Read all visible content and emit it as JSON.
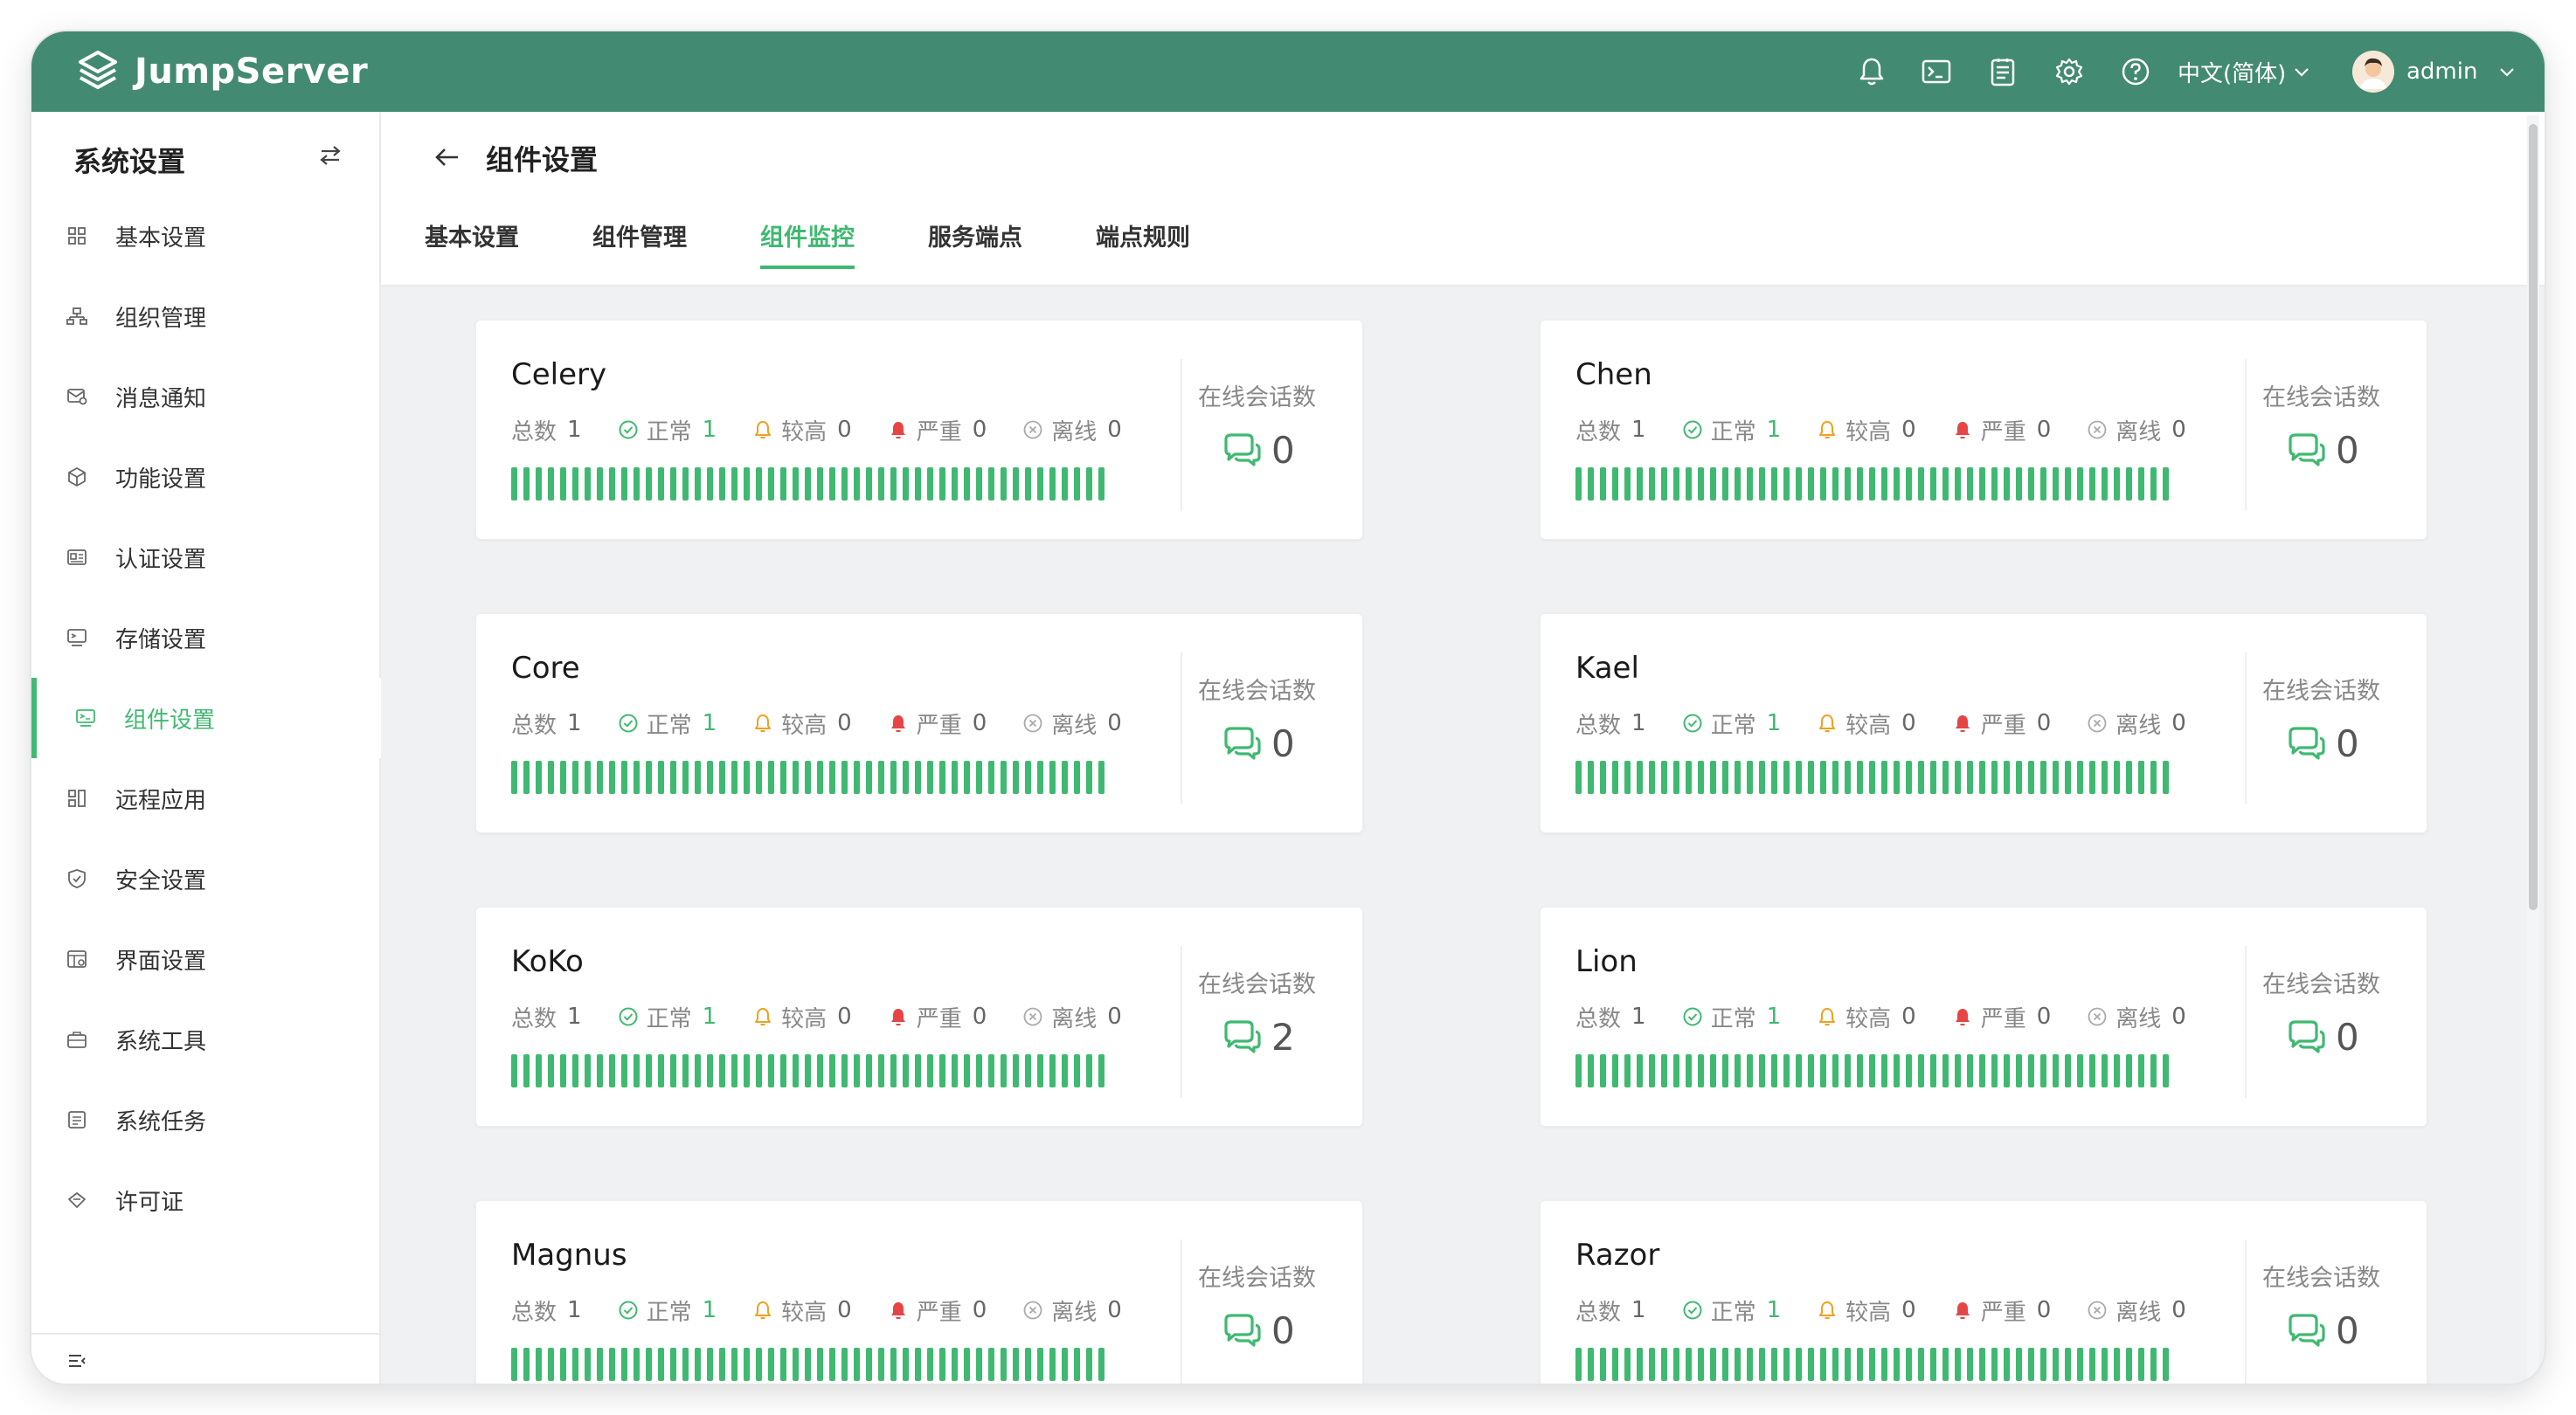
{
  "app": {
    "logo_text": "JumpServer"
  },
  "topbar": {
    "icons": [
      "bell-icon",
      "terminal-icon",
      "notes-icon",
      "settings-icon",
      "help-icon"
    ],
    "language": "中文(简体)",
    "user": "admin"
  },
  "sidebar": {
    "title": "系统设置",
    "items": [
      {
        "label": "基本设置",
        "icon": "grid-icon"
      },
      {
        "label": "组织管理",
        "icon": "org-tree-icon"
      },
      {
        "label": "消息通知",
        "icon": "message-icon"
      },
      {
        "label": "功能设置",
        "icon": "cube-icon"
      },
      {
        "label": "认证设置",
        "icon": "id-card-icon"
      },
      {
        "label": "存储设置",
        "icon": "storage-icon"
      },
      {
        "label": "组件设置",
        "icon": "component-icon",
        "active": true
      },
      {
        "label": "远程应用",
        "icon": "apps-icon"
      },
      {
        "label": "安全设置",
        "icon": "shield-icon"
      },
      {
        "label": "界面设置",
        "icon": "layout-icon"
      },
      {
        "label": "系统工具",
        "icon": "toolbox-icon"
      },
      {
        "label": "系统任务",
        "icon": "task-list-icon"
      },
      {
        "label": "许可证",
        "icon": "license-icon"
      }
    ]
  },
  "header": {
    "title": "组件设置",
    "tabs": [
      {
        "label": "基本设置"
      },
      {
        "label": "组件管理"
      },
      {
        "label": "组件监控",
        "active": true
      },
      {
        "label": "服务端点"
      },
      {
        "label": "端点规则"
      }
    ]
  },
  "labels": {
    "total": "总数",
    "normal": "正常",
    "high": "较高",
    "critical": "严重",
    "offline": "离线",
    "online_sessions": "在线会话数"
  },
  "colors": {
    "topbar": "#438a72",
    "accent": "#3fb971",
    "warning": "#f0a020",
    "danger": "#e64545",
    "muted": "#aaaaaa"
  },
  "components": [
    {
      "name": "Celery",
      "total": "1",
      "normal": "1",
      "high": "0",
      "critical": "0",
      "offline": "0",
      "sessions": "0"
    },
    {
      "name": "Chen",
      "total": "1",
      "normal": "1",
      "high": "0",
      "critical": "0",
      "offline": "0",
      "sessions": "0"
    },
    {
      "name": "Core",
      "total": "1",
      "normal": "1",
      "high": "0",
      "critical": "0",
      "offline": "0",
      "sessions": "0"
    },
    {
      "name": "Kael",
      "total": "1",
      "normal": "1",
      "high": "0",
      "critical": "0",
      "offline": "0",
      "sessions": "0"
    },
    {
      "name": "KoKo",
      "total": "1",
      "normal": "1",
      "high": "0",
      "critical": "0",
      "offline": "0",
      "sessions": "2"
    },
    {
      "name": "Lion",
      "total": "1",
      "normal": "1",
      "high": "0",
      "critical": "0",
      "offline": "0",
      "sessions": "0"
    },
    {
      "name": "Magnus",
      "total": "1",
      "normal": "1",
      "high": "0",
      "critical": "0",
      "offline": "0",
      "sessions": "0"
    },
    {
      "name": "Razor",
      "total": "1",
      "normal": "1",
      "high": "0",
      "critical": "0",
      "offline": "0",
      "sessions": "0"
    }
  ]
}
